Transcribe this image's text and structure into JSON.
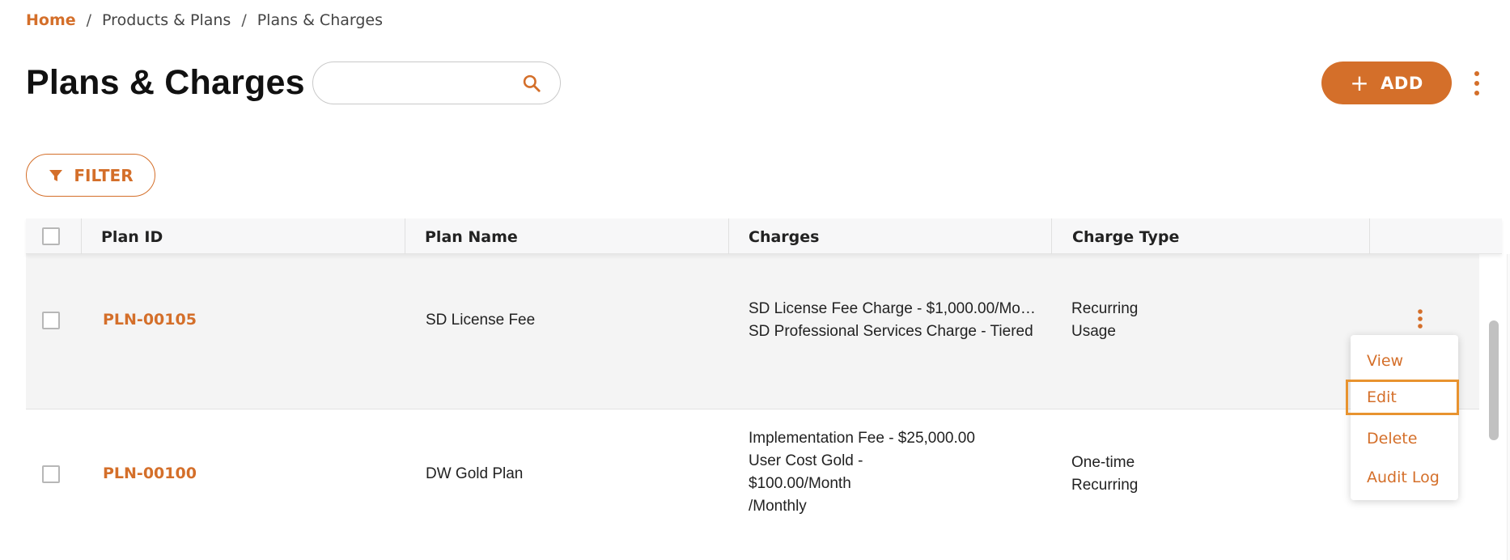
{
  "breadcrumb": {
    "home": "Home",
    "separator": "/",
    "items": [
      "Products & Plans",
      "Plans & Charges"
    ]
  },
  "header": {
    "title": "Plans & Charges",
    "search": {
      "value": "",
      "placeholder": ""
    },
    "add_button": {
      "icon": "+",
      "label": "ADD"
    }
  },
  "filter": {
    "label": "FILTER"
  },
  "table": {
    "columns": [
      "Plan ID",
      "Plan Name",
      "Charges",
      "Charge Type"
    ],
    "rows": [
      {
        "plan_id": "PLN-00105",
        "plan_name": "SD License Fee",
        "charges": [
          "SD License Fee Charge - $1,000.00/Mo…",
          "SD Professional Services Charge - Tiered"
        ],
        "charge_types": [
          "Recurring",
          "Usage"
        ]
      },
      {
        "plan_id": "PLN-00100",
        "plan_name": "DW Gold Plan",
        "charges": [
          "Implementation Fee - $25,000.00",
          "User Cost Gold -",
          "$100.00/Month",
          "/Monthly"
        ],
        "charge_types": [
          "One-time",
          "Recurring"
        ]
      }
    ]
  },
  "row_menu": {
    "items": [
      "View",
      "Edit",
      "Delete",
      "Audit Log"
    ],
    "focused": "Edit"
  },
  "colors": {
    "accent": "#d46f2a",
    "focus_outline": "#e8932f",
    "selected_row_bg": "#f4f4f4",
    "header_bg": "#f7f7f8"
  },
  "icons": {
    "search": "search-icon",
    "filter": "filter-icon",
    "more": "more-vertical-icon",
    "add": "plus-icon"
  }
}
